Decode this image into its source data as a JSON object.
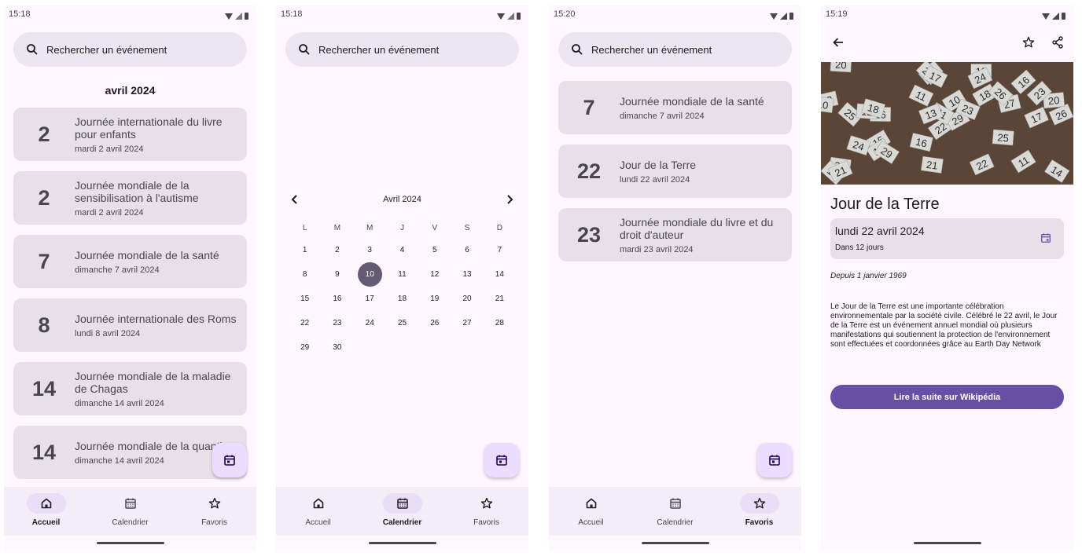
{
  "screens": {
    "home": {
      "time": "15:18",
      "search_placeholder": "Rechercher un événement",
      "month": "avril 2024",
      "events": [
        {
          "day": "2",
          "title": "Journée internationale du livre pour enfants",
          "date": "mardi 2 avril 2024"
        },
        {
          "day": "2",
          "title": "Journée mondiale de la sensibilisation à l'autisme",
          "date": "mardi 2 avril 2024"
        },
        {
          "day": "7",
          "title": "Journée mondiale de la santé",
          "date": "dimanche 7 avril 2024"
        },
        {
          "day": "8",
          "title": "Journée internationale des Roms",
          "date": "lundi 8 avril 2024"
        },
        {
          "day": "14",
          "title": "Journée mondiale de la maladie de Chagas",
          "date": "dimanche 14 avril 2024"
        },
        {
          "day": "14",
          "title": "Journée mondiale de la quantiт",
          "date": "dimanche 14 avril 2024"
        }
      ]
    },
    "calendar": {
      "time": "15:18",
      "search_placeholder": "Rechercher un événement",
      "month_title": "Avril 2024",
      "weekdays": [
        "L",
        "M",
        "M",
        "J",
        "V",
        "S",
        "D"
      ],
      "days": [
        "1",
        "2",
        "3",
        "4",
        "5",
        "6",
        "7",
        "8",
        "9",
        "10",
        "11",
        "12",
        "13",
        "14",
        "15",
        "16",
        "17",
        "18",
        "19",
        "20",
        "21",
        "22",
        "23",
        "24",
        "25",
        "26",
        "27",
        "28",
        "29",
        "30"
      ],
      "selected_day": "10"
    },
    "favorites": {
      "time": "15:20",
      "search_placeholder": "Rechercher un événement",
      "events": [
        {
          "day": "7",
          "title": "Journée mondiale de la santé",
          "date": "dimanche 7 avril 2024"
        },
        {
          "day": "22",
          "title": "Jour de la Terre",
          "date": "lundi 22 avril 2024"
        },
        {
          "day": "23",
          "title": "Journée mondiale du livre et du droit d'auteur",
          "date": "mardi 23 avril 2024"
        }
      ]
    },
    "detail": {
      "time": "15:19",
      "title": "Jour de la Terre",
      "date": "lundi 22 avril 2024",
      "countdown": "Dans 12 jours",
      "since": "Depuis 1 janvier 1969",
      "description": "Le Jour de la Terre est une importante célébration environnementale par la société civile. Célébré le 22 avril, le Jour de la Terre est un événement annuel mondial où plusieurs manifestations qui soutiennent la protection de l'environnement sont effectuées et coordonnées grâce au Earth Day Network",
      "button": "Lire la suite sur Wikipédia",
      "hero_numbers": [
        "22",
        "16",
        "20",
        "11",
        "13",
        "15",
        "29",
        "14",
        "25",
        "12",
        "18",
        "26",
        "10",
        "27",
        "21",
        "17",
        "23",
        "24"
      ]
    }
  },
  "nav": {
    "home": "Accueil",
    "calendar": "Calendrier",
    "favorites": "Favoris"
  },
  "colors": {
    "surface": "#fef7ff",
    "card": "#e7e0e8",
    "primary": "#6750a4",
    "nav_active": "#e8def8",
    "fab": "#eaddff"
  }
}
